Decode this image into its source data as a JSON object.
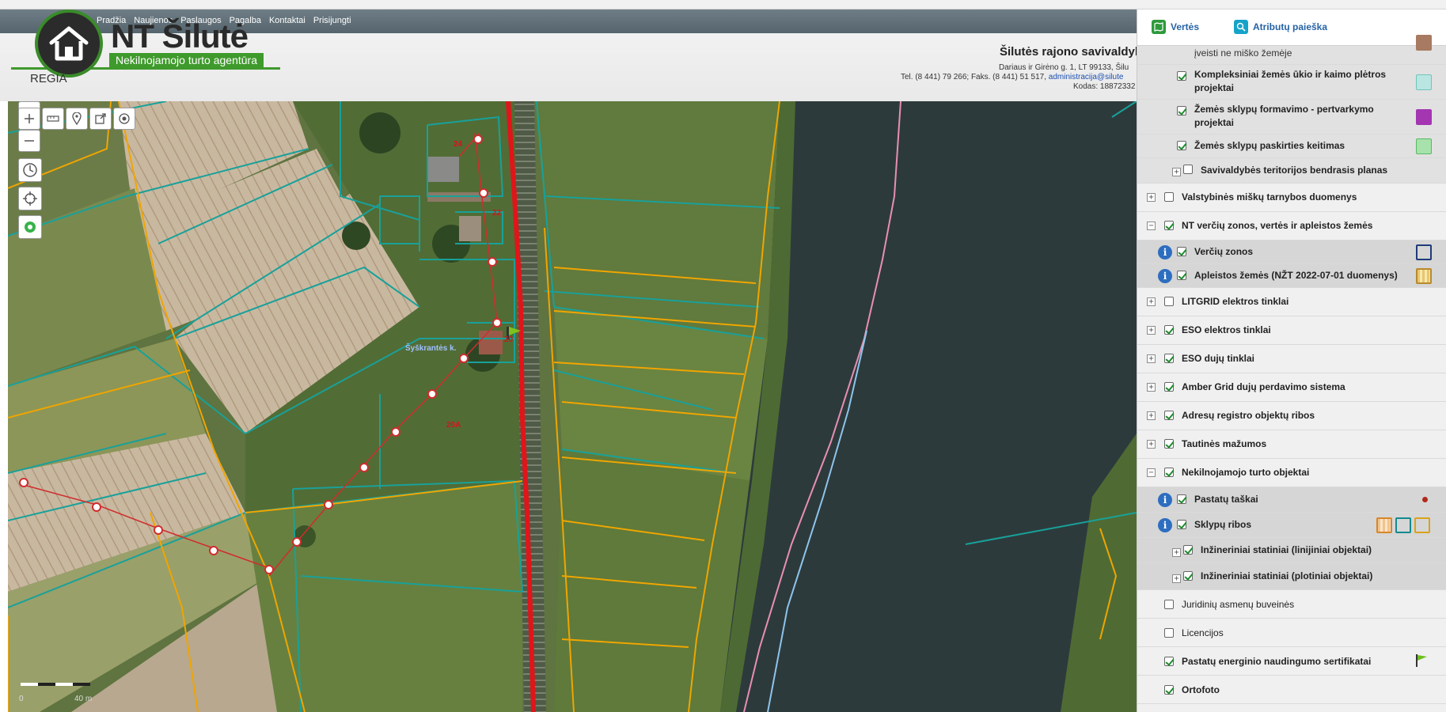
{
  "header": {
    "nav": [
      "Pradžia",
      "Naujienos",
      "Paslaugos",
      "Pagalba",
      "Kontaktai",
      "Prisijungti"
    ],
    "logo_title": "NT Šilutė",
    "logo_subtitle": "Nekilnojamojo turto agentūra",
    "logo_regia": "REGIA",
    "municipality": "Šilutės rajono savivaldyb",
    "address": "Dariaus ir Girėno g. 1, LT 99133, Šilu",
    "tel": "Tel. (8 441) 79 266; Faks. (8 441) 51 517, ",
    "email": "administracija@silute",
    "code": "Kodas: 18872332"
  },
  "map": {
    "labels": {
      "house_24": "24",
      "house_22": "22",
      "house_20": "20",
      "parcel_20a": "20A",
      "village": "Šyškrantės k.",
      "scale_left": "0",
      "scale_right": "40 m"
    },
    "tools": [
      "zoom-in",
      "zoom-out",
      "measure",
      "place",
      "share",
      "locate",
      "history",
      "crosshair",
      "settings"
    ]
  },
  "panel": {
    "tabs": {
      "values": "Vertės",
      "attr_search": "Atributų paieška"
    },
    "colors": {
      "accent_tab": "#2563a6",
      "checkbox": "#1d8a2e",
      "info": "#2d6ec0"
    },
    "layers": {
      "r0": "įveisti ne miško žemėje",
      "r1a": "Kompleksiniai žemės ūkio ir kaimo plėtros",
      "r1b": "projektai",
      "r2a": "Žemės sklypų formavimo - pertvarkymo",
      "r2b": "projektai",
      "r3": "Žemės sklypų paskirties keitimas",
      "r4": "Savivaldybės teritorijos bendrasis planas",
      "r5": "Valstybinės miškų tarnybos duomenys",
      "r6": "NT verčių zonos, vertės ir apleistos žemės",
      "r7": "Verčių zonos",
      "r8": "Apleistos žemės (NŽT 2022-07-01 duomenys)",
      "r9": "LITGRID elektros tinklai",
      "r10": "ESO elektros tinklai",
      "r11": "ESO dujų tinklai",
      "r12": "Amber Grid dujų perdavimo sistema",
      "r13": "Adresų registro objektų ribos",
      "r14": "Tautinės mažumos",
      "r15": "Nekilnojamojo turto objektai",
      "r16": "Pastatų taškai",
      "r17": "Sklypų ribos",
      "r18": "Inžineriniai statiniai (linijiniai objektai)",
      "r19": "Inžineriniai statiniai (plotiniai objektai)",
      "r20": "Juridinių asmenų buveinės",
      "r21": "Licencijos",
      "r22": "Pastatų energinio naudingumo sertifikatai",
      "r23": "Ortofoto"
    }
  }
}
